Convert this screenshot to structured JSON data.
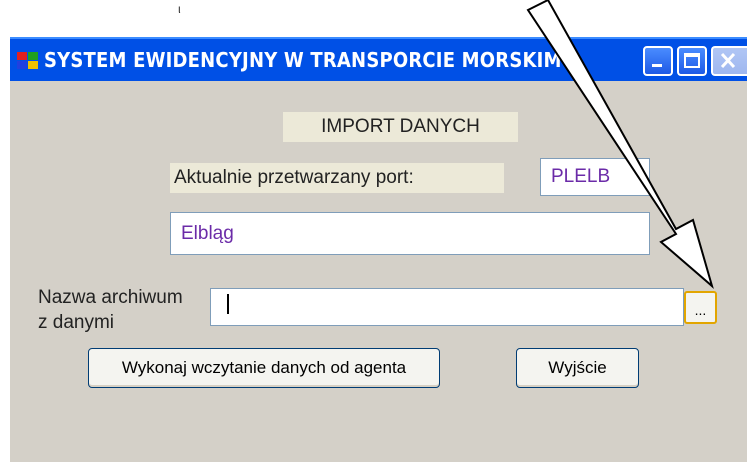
{
  "window": {
    "title": "SYSTEM  EWIDENCYJNY  W  TRANSPORCIE  MORSKIM",
    "minimize_icon": "minimize-icon",
    "maximize_icon": "maximize-icon",
    "close_icon": "close-icon"
  },
  "form": {
    "heading": "IMPORT DANYCH",
    "port_label": "Aktualnie przetwarzany port:",
    "port_code": "PLELB",
    "port_name": "Elbląg",
    "archive_label_line1": "Nazwa archiwum",
    "archive_label_line2": "z danymi",
    "archive_value": "",
    "browse_label": "...",
    "run_button": "Wykonaj wczytanie danych od agenta",
    "exit_button": "Wyjście"
  },
  "colors": {
    "titlebar": "#0050e6",
    "window_bg": "#d4d0c8",
    "field_text": "#6b2ba8",
    "browse_border": "#e2a500"
  }
}
